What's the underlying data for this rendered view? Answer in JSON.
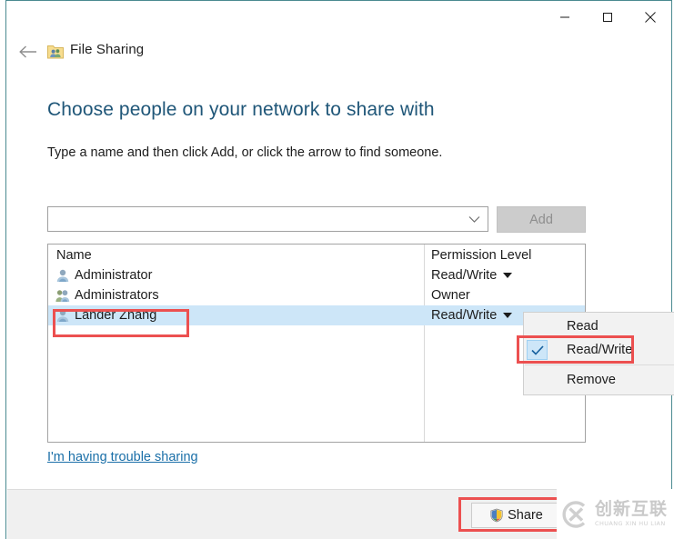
{
  "window": {
    "app_title": "File Sharing",
    "app_icon": "file-sharing-folder-icon",
    "back_icon": "back-arrow-icon",
    "caption": {
      "minimize_icon": "minimize-icon",
      "maximize_icon": "maximize-icon",
      "close_icon": "close-icon"
    }
  },
  "content": {
    "heading": "Choose people on your network to share with",
    "subheading": "Type a name and then click Add, or click the arrow to find someone.",
    "heading_color": "#1f5678"
  },
  "entry": {
    "combo_value": "",
    "combo_placeholder": "",
    "combo_arrow_icon": "chevron-down-icon",
    "add_label": "Add",
    "add_enabled": false
  },
  "list": {
    "columns": [
      "Name",
      "Permission Level"
    ],
    "rows": [
      {
        "name": "Administrator",
        "icon": "single-user-icon",
        "permission": "Read/Write",
        "has_caret": true,
        "selected": false
      },
      {
        "name": "Administrators",
        "icon": "user-group-icon",
        "permission": "Owner",
        "has_caret": false,
        "selected": false
      },
      {
        "name": "Lander Zhang",
        "icon": "single-user-icon",
        "permission": "Read/Write",
        "has_caret": true,
        "selected": true
      }
    ],
    "selected_row_color": "#cde6f8"
  },
  "menu": {
    "items": [
      {
        "label": "Read",
        "checked": false
      },
      {
        "label": "Read/Write",
        "checked": true
      },
      {
        "label": "Remove",
        "checked": false
      }
    ],
    "check_icon": "checkmark-icon"
  },
  "links": {
    "trouble": "I'm having trouble sharing",
    "trouble_color": "#1a6fa8"
  },
  "footer": {
    "share_label": "Share",
    "share_icon": "uac-shield-icon"
  },
  "watermark": {
    "logo_icon": "cx-logo-icon",
    "chinese": "创新互联",
    "pinyin": "CHUANG XIN HU LIAN"
  },
  "annotations": {
    "color": "#ec5050",
    "boxes": [
      "selected-user-row",
      "read-write-menu-item",
      "share-button"
    ]
  }
}
